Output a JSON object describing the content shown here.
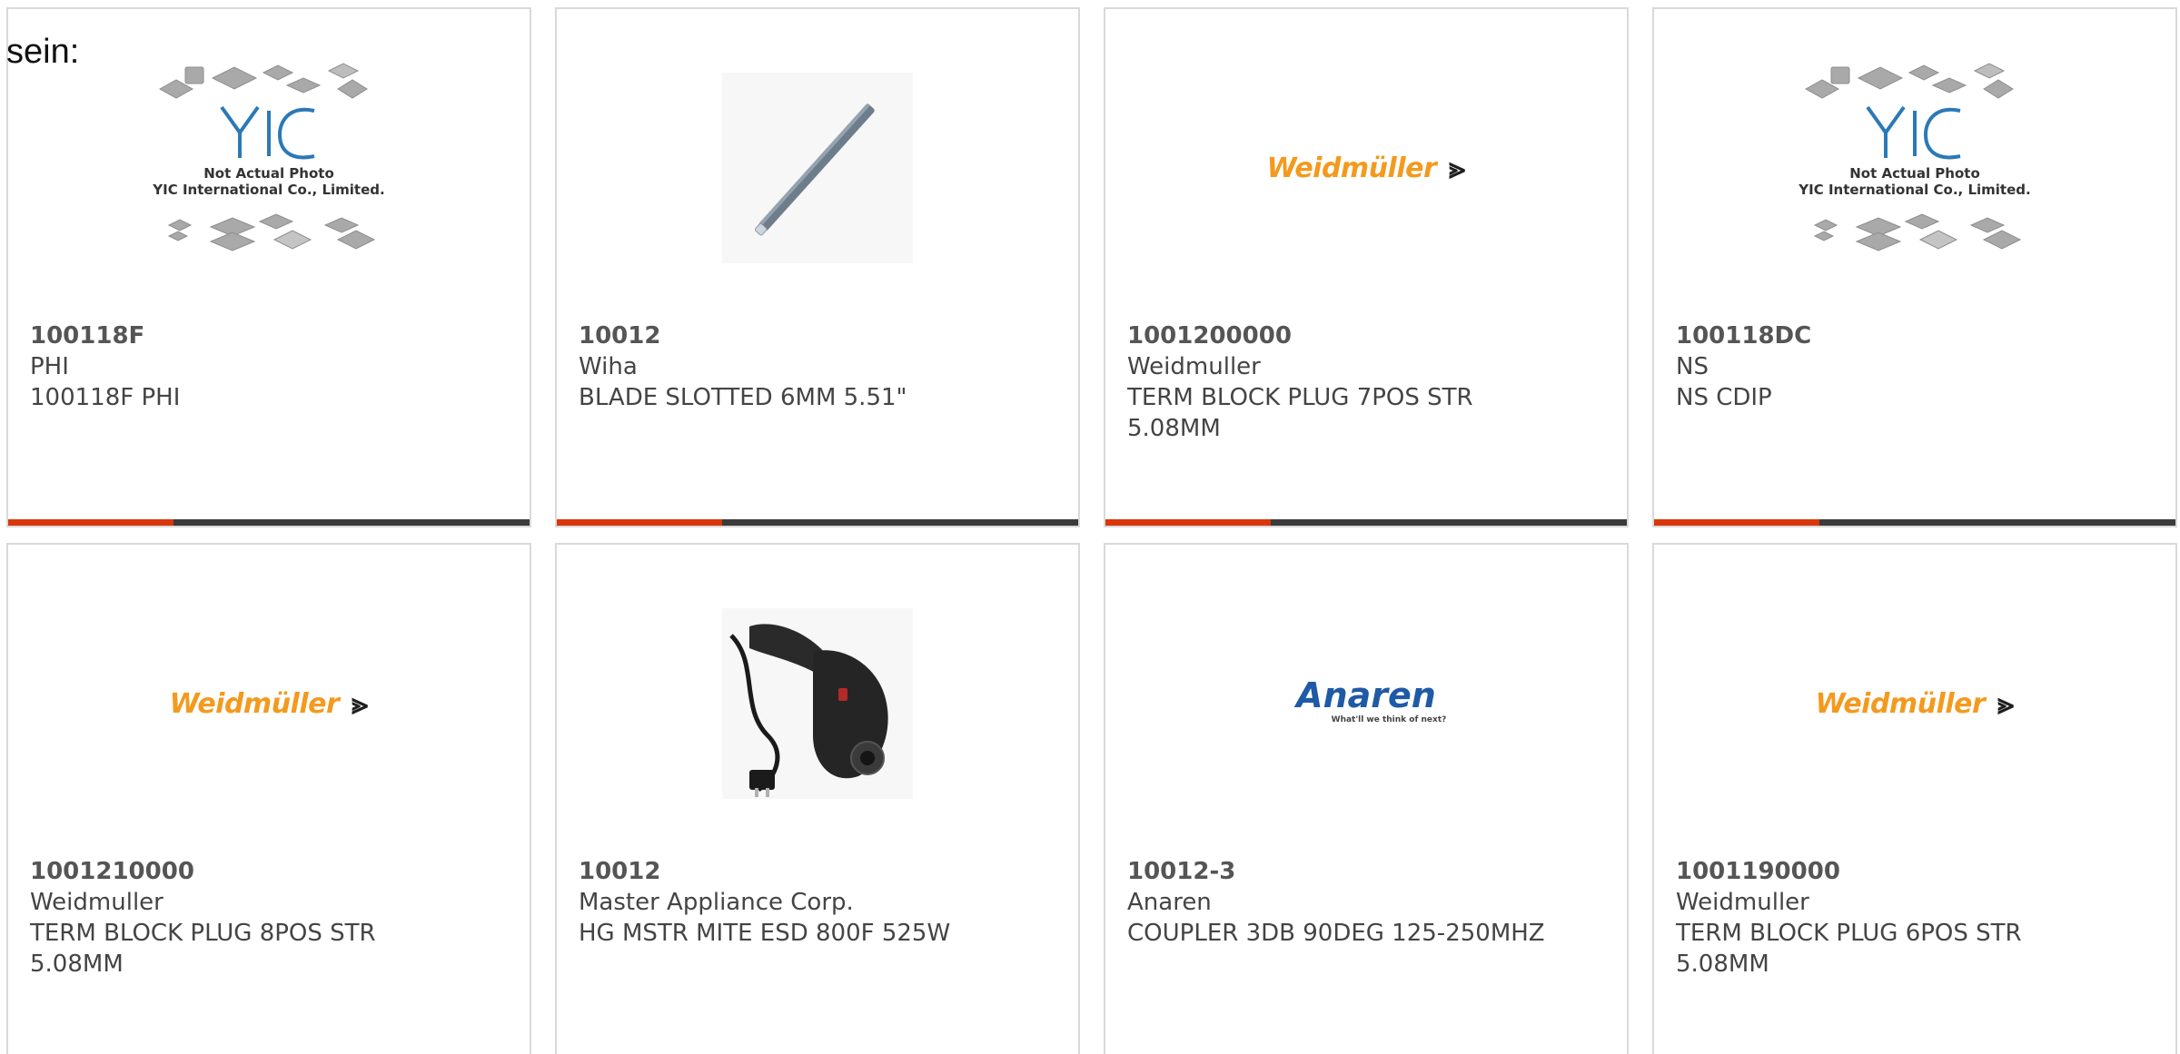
{
  "intro": "sein:",
  "colors": {
    "accent_bar": "#d9360b",
    "dark_bar": "#3b3b3b",
    "card_border": "#d9d9d9",
    "weidmuller_orange": "#f39a1e",
    "anaren_blue": "#1f5aa6"
  },
  "placeholder_image": {
    "brand": "YIC",
    "line1": "Not Actual Photo",
    "line2": "YIC International Co., Limited."
  },
  "logos": {
    "weidmuller": "Weidmüller",
    "anaren": "Anaren",
    "anaren_tagline": "What'll we think of next?"
  },
  "cards": [
    {
      "image": "yic-placeholder",
      "part_number": "100118F",
      "manufacturer": "PHI",
      "description": "100118F PHI"
    },
    {
      "image": "screwdriver-blade",
      "part_number": "10012",
      "manufacturer": "Wiha",
      "description": "BLADE SLOTTED 6MM 5.51\""
    },
    {
      "image": "weidmuller-logo",
      "part_number": "1001200000",
      "manufacturer": "Weidmuller",
      "description": "TERM BLOCK PLUG 7POS STR 5.08MM"
    },
    {
      "image": "yic-placeholder",
      "part_number": "100118DC",
      "manufacturer": "NS",
      "description": "NS CDIP"
    },
    {
      "image": "weidmuller-logo",
      "part_number": "1001210000",
      "manufacturer": "Weidmuller",
      "description": "TERM BLOCK PLUG 8POS STR 5.08MM"
    },
    {
      "image": "heat-gun",
      "part_number": "10012",
      "manufacturer": "Master Appliance Corp.",
      "description": "HG MSTR MITE ESD 800F 525W"
    },
    {
      "image": "anaren-logo",
      "part_number": "10012-3",
      "manufacturer": "Anaren",
      "description": "COUPLER 3DB 90DEG 125-250MHZ"
    },
    {
      "image": "weidmuller-logo",
      "part_number": "1001190000",
      "manufacturer": "Weidmuller",
      "description": "TERM BLOCK PLUG 6POS STR 5.08MM"
    }
  ]
}
